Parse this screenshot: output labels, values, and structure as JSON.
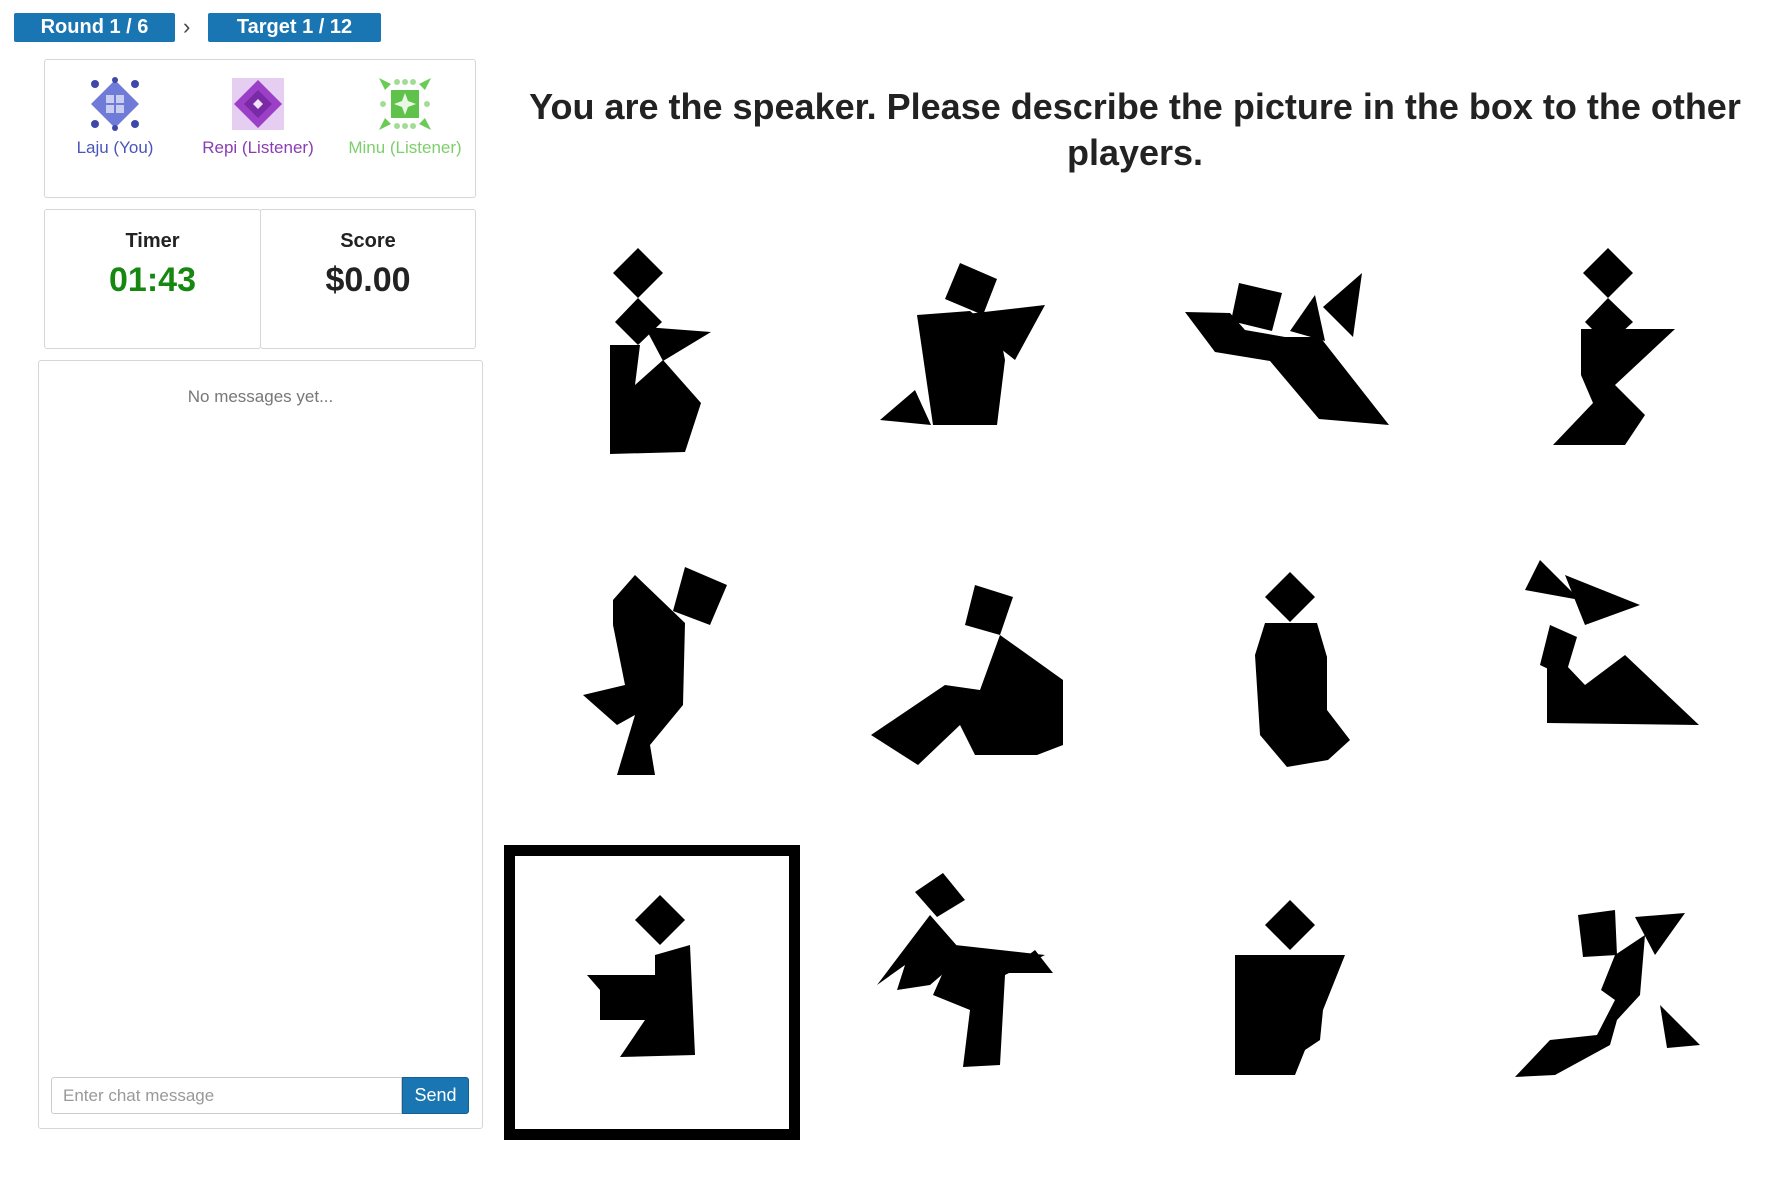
{
  "breadcrumb": {
    "round": "Round 1 / 6",
    "separator": "›",
    "target": "Target 1 / 12"
  },
  "players": [
    {
      "label": "Laju (You)",
      "color": "#4a55b8"
    },
    {
      "label": "Repi (Listener)",
      "color": "#8a3db3"
    },
    {
      "label": "Minu (Listener)",
      "color": "#7ccf6a"
    }
  ],
  "stats": {
    "timer_label": "Timer",
    "timer_value": "01:43",
    "score_label": "Score",
    "score_value": "$0.00"
  },
  "chat": {
    "empty_text": "No messages yet...",
    "input_placeholder": "Enter chat message",
    "input_value": "",
    "send_label": "Send"
  },
  "instruction": "You are the speaker. Please describe the picture in the box to the other players.",
  "grid": {
    "rows": 3,
    "cols": 4,
    "target_index": 8,
    "figure_color": "#000000"
  }
}
